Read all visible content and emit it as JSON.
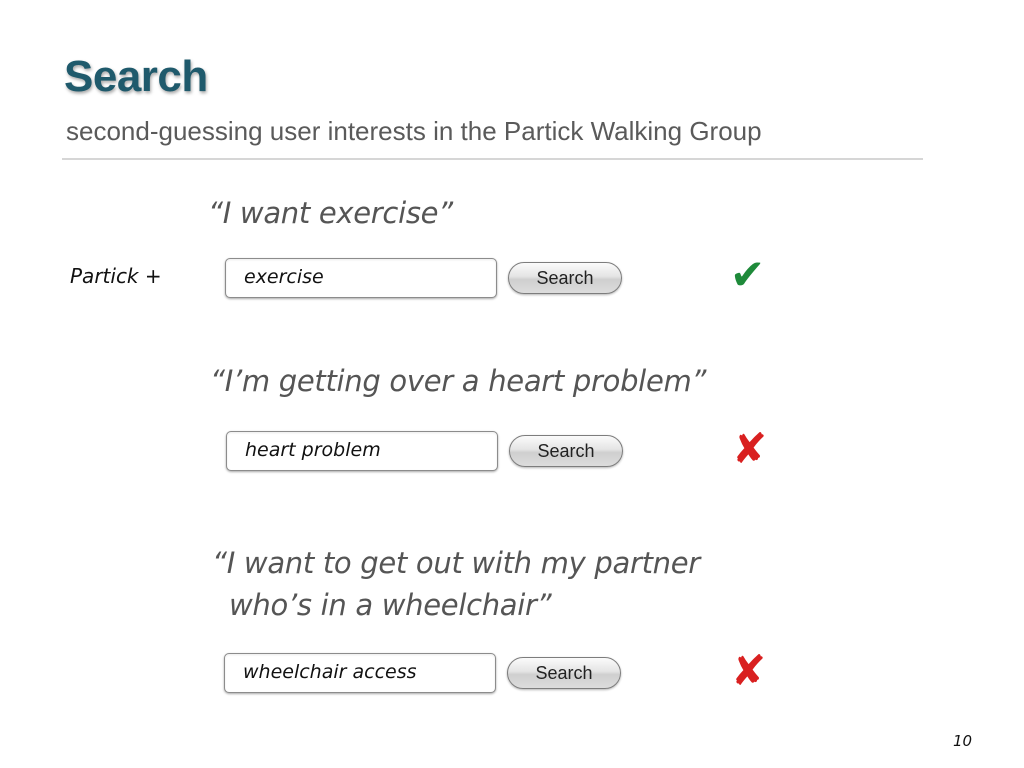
{
  "slide": {
    "title": "Search",
    "subtitle": "second-guessing user interests in the Partick Walking Group",
    "prefix_label": "Partick +",
    "page_number": "10"
  },
  "examples": [
    {
      "quote_line1": "“I want exercise”",
      "quote_line2": "",
      "query": "exercise",
      "button_label": "Search",
      "result": "✔",
      "result_color": "#1e8a3a"
    },
    {
      "quote_line1": "“I’m getting over a heart problem”",
      "quote_line2": "",
      "query": "heart problem",
      "button_label": "Search",
      "result": "✘",
      "result_color": "#d92020"
    },
    {
      "quote_line1": "“I want to get out with my partner",
      "quote_line2": "who’s in a wheelchair”",
      "query": "wheelchair access",
      "button_label": "Search",
      "result": "✘",
      "result_color": "#d92020"
    }
  ],
  "colors": {
    "title": "#1f5a6c",
    "subtitle": "#5a5a5a",
    "quote": "#555555",
    "check": "#1e8a3a",
    "cross": "#d92020"
  }
}
